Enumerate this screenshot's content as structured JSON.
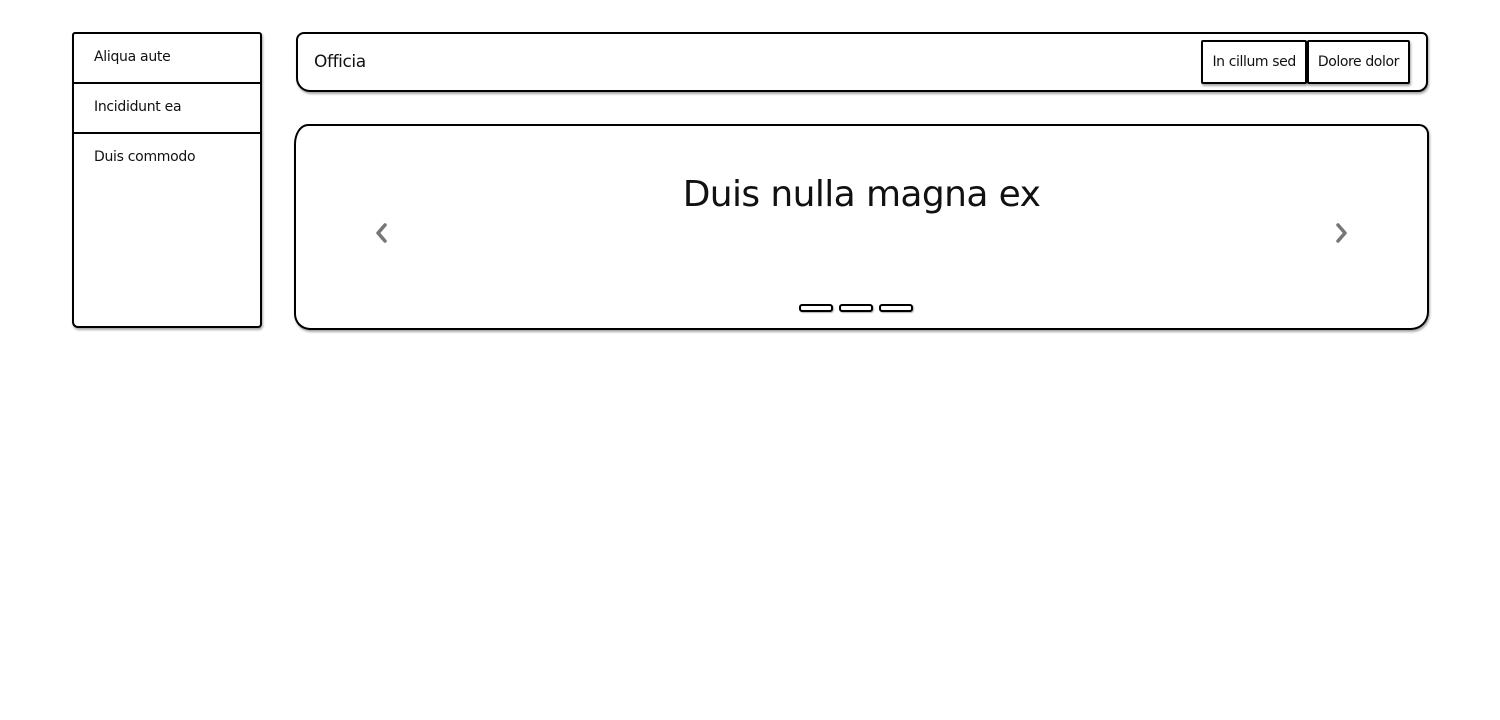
{
  "sidebar": {
    "items": [
      {
        "label": "Aliqua aute"
      },
      {
        "label": "Incididunt ea"
      },
      {
        "label": "Duis commodo"
      }
    ]
  },
  "header": {
    "title": "Officia",
    "buttons": [
      {
        "label": "In cillum sed"
      },
      {
        "label": "Dolore dolor"
      }
    ]
  },
  "carousel": {
    "heading": "Duis nulla magna ex",
    "prev_icon": "chevron-left-icon",
    "next_icon": "chevron-right-icon",
    "slide_count": 3,
    "arrow_color": "#777777"
  }
}
